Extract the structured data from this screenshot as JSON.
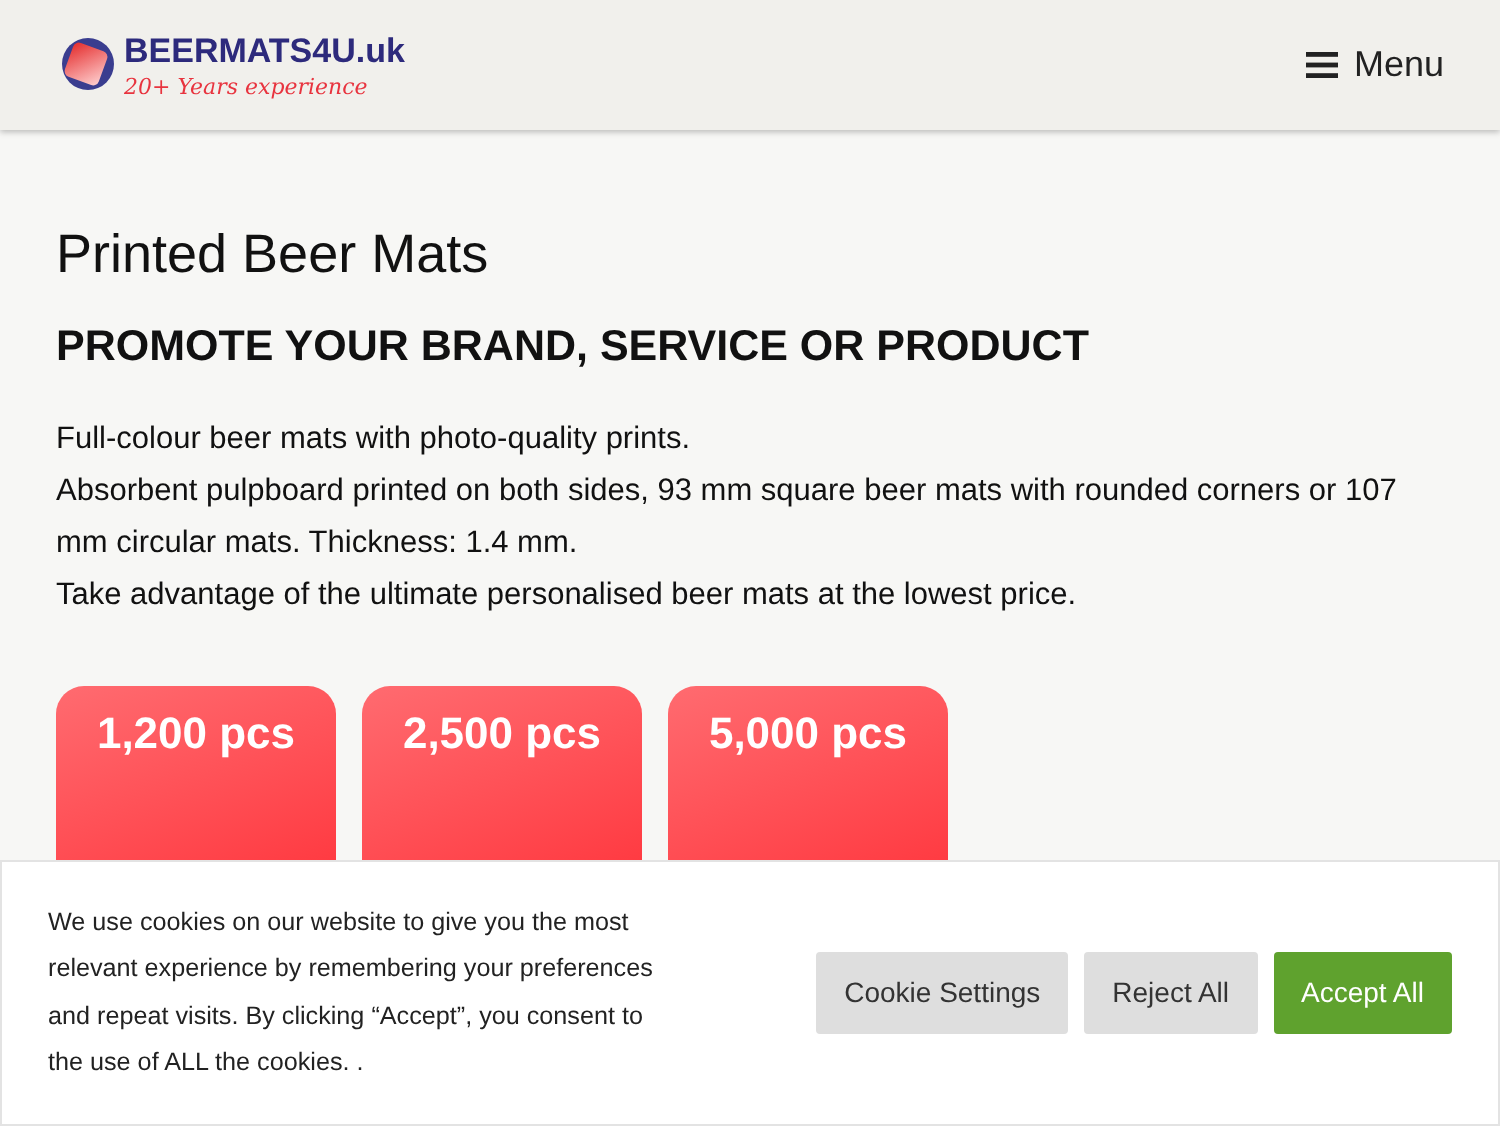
{
  "header": {
    "logo_text": "BEERMATS4U.uk",
    "tagline": "20+ Years experience",
    "menu_label": "Menu"
  },
  "heading": "Printed Beer Mats",
  "subheading": "PROMOTE YOUR BRAND, SERVICE OR PRODUCT",
  "paragraphs": [
    "Full-colour beer mats with photo-quality prints.",
    "Absorbent pulpboard printed on both sides, 93 mm square beer mats with rounded corners or 107 mm circular mats. Thickness: 1.4 mm.",
    "Take advantage of the ultimate personalised beer mats at the lowest price."
  ],
  "packages": [
    {
      "quantity": "1,200 pcs"
    },
    {
      "quantity": "2,500 pcs"
    },
    {
      "quantity": "5,000 pcs"
    }
  ],
  "cookie_banner": {
    "text": "We use cookies on our website to give you the most relevant experience by remembering your preferences and repeat visits. By clicking “Accept”, you consent to the use of ALL the cookies. .",
    "buttons": [
      {
        "label": "Cookie Settings",
        "kind": "neutral"
      },
      {
        "label": "Reject All",
        "kind": "neutral"
      },
      {
        "label": "Accept All",
        "kind": "accept"
      }
    ]
  }
}
